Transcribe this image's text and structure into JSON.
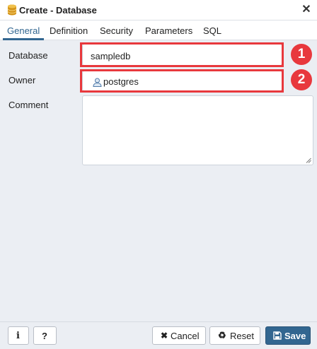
{
  "window": {
    "title": "Create - Database",
    "title_icon": "database-icon",
    "close_icon": "close-icon"
  },
  "tabs": [
    {
      "label": "General",
      "active": true
    },
    {
      "label": "Definition",
      "active": false
    },
    {
      "label": "Security",
      "active": false
    },
    {
      "label": "Parameters",
      "active": false
    },
    {
      "label": "SQL",
      "active": false
    }
  ],
  "form": {
    "database": {
      "label": "Database",
      "value": "sampledb"
    },
    "owner": {
      "label": "Owner",
      "value": "postgres",
      "icon": "user-icon"
    },
    "comment": {
      "label": "Comment",
      "value": ""
    }
  },
  "annotations": [
    {
      "number": "1"
    },
    {
      "number": "2"
    }
  ],
  "footer": {
    "info_label": "i",
    "help_label": "?",
    "cancel_label": "Cancel",
    "reset_label": "Reset",
    "save_label": "Save"
  },
  "colors": {
    "accent": "#326690",
    "highlight": "#e8383d",
    "background": "#ebeef3"
  }
}
